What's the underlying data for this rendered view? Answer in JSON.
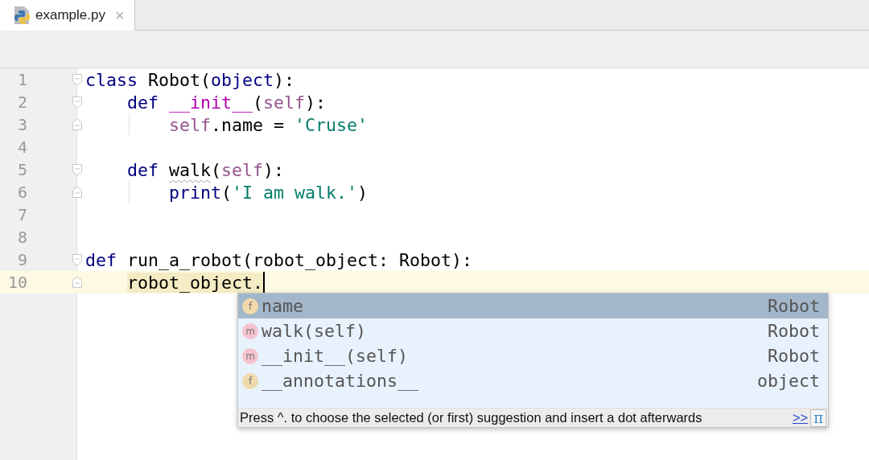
{
  "tabs": [
    {
      "label": "example.py",
      "close": "×",
      "selected": true
    }
  ],
  "editor": {
    "lines": [
      {
        "number": "1",
        "fold_start": true,
        "fold_end": false,
        "current": false,
        "indent_guide": false,
        "segments": [
          {
            "kind": "keyword",
            "text": "class"
          },
          {
            "kind": "plain",
            "text": " Robot("
          },
          {
            "kind": "keyword",
            "text": "object"
          },
          {
            "kind": "plain",
            "text": "):"
          }
        ]
      },
      {
        "number": "2",
        "fold_start": true,
        "fold_end": false,
        "current": false,
        "indent_guide": false,
        "segments": [
          {
            "kind": "keyword",
            "text": "    def "
          },
          {
            "kind": "magic",
            "text": "__init__"
          },
          {
            "kind": "plain",
            "text": "("
          },
          {
            "kind": "self",
            "text": "self"
          },
          {
            "kind": "plain",
            "text": "):"
          }
        ]
      },
      {
        "number": "3",
        "fold_start": false,
        "fold_end": true,
        "current": false,
        "indent_guide": true,
        "segments": [
          {
            "kind": "self",
            "text": "        self"
          },
          {
            "kind": "plain",
            "text": ".name = "
          },
          {
            "kind": "string",
            "text": "'Cruse'"
          }
        ]
      },
      {
        "number": "4",
        "fold_start": false,
        "fold_end": false,
        "current": false,
        "indent_guide": false
      },
      {
        "number": "5",
        "fold_start": true,
        "fold_end": false,
        "current": false,
        "indent_guide": false,
        "segments": [
          {
            "kind": "keyword",
            "text": "    def "
          },
          {
            "kind": "warned",
            "text": "walk"
          },
          {
            "kind": "plain",
            "text": "("
          },
          {
            "kind": "self",
            "text": "self"
          },
          {
            "kind": "plain",
            "text": "):"
          }
        ]
      },
      {
        "number": "6",
        "fold_start": false,
        "fold_end": true,
        "current": false,
        "indent_guide": true,
        "segments": [
          {
            "kind": "keyword",
            "text": "        print"
          },
          {
            "kind": "plain",
            "text": "("
          },
          {
            "kind": "string",
            "text": "'I am walk.'"
          },
          {
            "kind": "plain",
            "text": ")"
          }
        ]
      },
      {
        "number": "7",
        "fold_start": false,
        "fold_end": false,
        "current": false,
        "indent_guide": false
      },
      {
        "number": "8",
        "fold_start": false,
        "fold_end": false,
        "current": false,
        "indent_guide": false
      },
      {
        "number": "9",
        "fold_start": true,
        "fold_end": false,
        "current": false,
        "indent_guide": false,
        "segments": [
          {
            "kind": "keyword",
            "text": "def"
          },
          {
            "kind": "plain",
            "text": " run_a_robot(robot_object: Robot):"
          }
        ]
      },
      {
        "number": "10",
        "fold_start": false,
        "fold_end": true,
        "current": true,
        "indent_guide": false,
        "segments": [
          {
            "kind": "usage",
            "text": "    robot_object."
          }
        ]
      }
    ]
  },
  "completion": {
    "items": [
      {
        "kind": "field",
        "badge": "f",
        "name": "name",
        "type": "Robot",
        "selected": true
      },
      {
        "kind": "method",
        "badge": "m",
        "name": "walk(self)",
        "type": "Robot",
        "selected": false
      },
      {
        "kind": "method",
        "badge": "m",
        "name": "__init__(self)",
        "type": "Robot",
        "selected": false
      },
      {
        "kind": "field",
        "badge": "f",
        "name": "__annotations__",
        "type": "object",
        "selected": false
      }
    ],
    "hint": "Press ^. to choose the selected (or first) suggestion and insert a dot afterwards",
    "hint_link": ">>",
    "pin": "π"
  }
}
